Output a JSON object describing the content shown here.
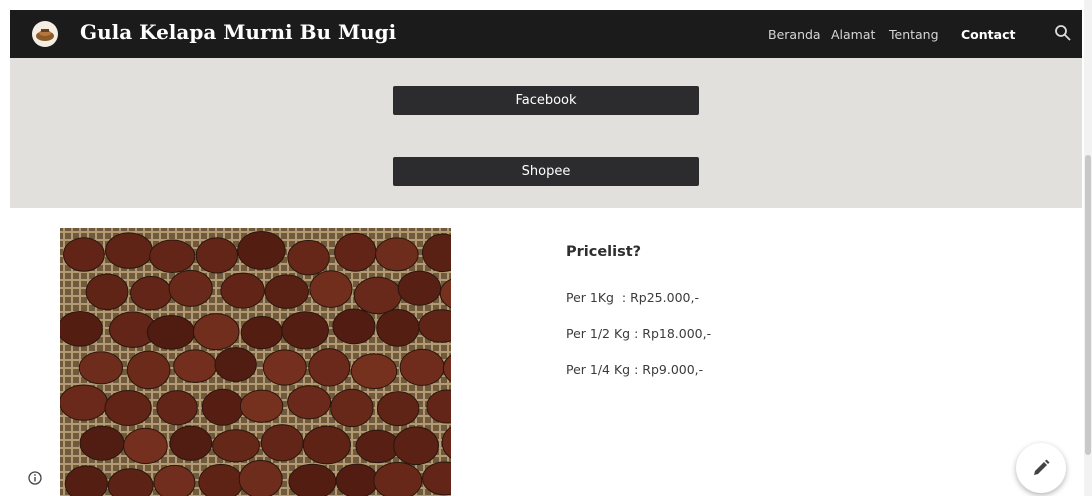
{
  "header": {
    "site_title": "Gula Kelapa Murni Bu Mugi",
    "nav": [
      "Beranda",
      "Alamat",
      "Tentang",
      "Contact"
    ],
    "active_nav": "Contact",
    "search_icon": "search-icon",
    "background_color": "#1c1b1b"
  },
  "links_band": {
    "background_color": "#e1e0dd",
    "buttons": [
      "Facebook",
      "Shopee"
    ]
  },
  "product": {
    "image_icon": "palm-sugar-photo"
  },
  "pricelist": {
    "title": "Pricelist?",
    "items": [
      "Per 1Kg  : Rp25.000,-",
      "Per 1/2 Kg : Rp18.000,-",
      "Per 1/4 Kg : Rp9.000,-"
    ]
  },
  "footer": {
    "info_icon": "info-icon",
    "edit_icon": "pencil-icon"
  }
}
